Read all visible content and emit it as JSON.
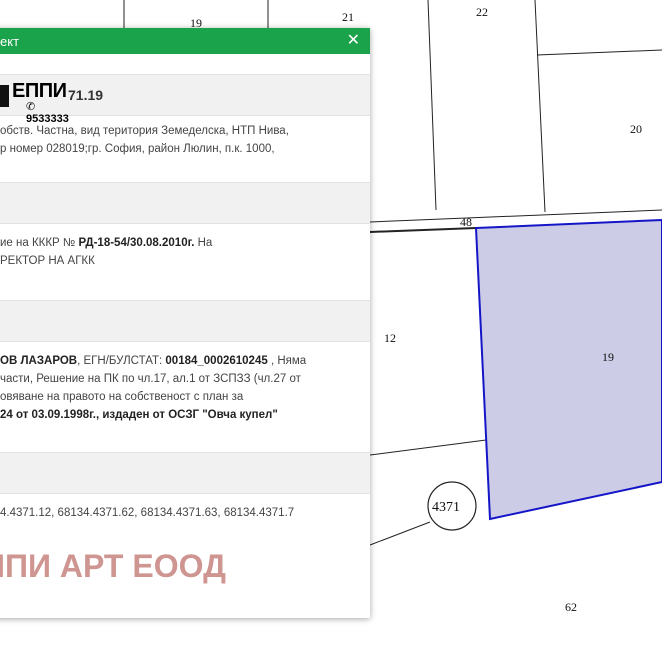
{
  "map": {
    "parcel_numbers": {
      "top_a": "19",
      "top_b": "21",
      "top_c": "22",
      "right_20": "20",
      "road": "48",
      "left_12": "12",
      "selected": "19",
      "circle": "4371",
      "bottom": "62"
    },
    "selected_fill": "#cccce6",
    "selected_stroke": "#1515c8"
  },
  "panel": {
    "title": "ект",
    "close_icon": "close-icon",
    "header_color": "#1aa34a",
    "logo": {
      "word": "ЕППИ",
      "phone": "✆ 9533333",
      "ident_suffix": "71.19"
    },
    "section1": {
      "line1": "обств. Частна, вид територия Земеделска, НТП Нива,",
      "line2": "р номер 028019;гр. София, район Люлин, п.к. 1000,"
    },
    "section2": {
      "line1_prefix": "ие на КККР № ",
      "line1_bold": "РД-18-54/30.08.2010г.",
      "line1_suffix": " На",
      "line2": "РЕКТОР НА АГКК"
    },
    "section3": {
      "line1_bold": "ОВ ЛАЗАРОВ",
      "line1_mid": ", ЕГН/БУЛСТАТ: ",
      "line1_bold2": "00184_0002610245",
      "line1_suffix": " , Няма",
      "line2": "части, Решение на ПК по чл.17, ал.1 от ЗСПЗЗ (чл.27 от",
      "line3": "овяване на правото на собственост с план за",
      "line4_bold": "24 от 03.09.1998г., издаден от ОСЗГ \"Овча купел\""
    },
    "section4": {
      "line1": "4.4371.12, 68134.4371.62, 68134.4371.63, 68134.4371.7"
    },
    "watermark": "ППИ АРТ ЕООД"
  }
}
